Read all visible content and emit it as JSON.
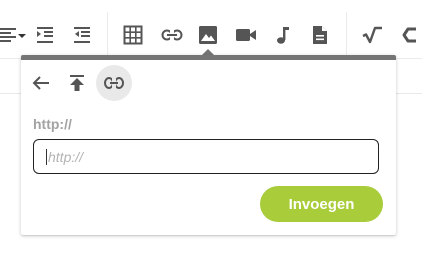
{
  "toolbar": {
    "buttons": [
      {
        "name": "align-dropdown-icon"
      },
      {
        "name": "indent-icon"
      },
      {
        "name": "outdent-icon"
      },
      {
        "name": "table-icon"
      },
      {
        "name": "link-icon"
      },
      {
        "name": "image-icon"
      },
      {
        "name": "video-icon"
      },
      {
        "name": "audio-icon"
      },
      {
        "name": "file-icon"
      },
      {
        "name": "math-icon"
      },
      {
        "name": "code-icon"
      }
    ],
    "active": "image-icon"
  },
  "popup": {
    "actions": [
      "back-icon",
      "upload-icon",
      "link-icon"
    ],
    "selected_action": "link-icon",
    "field_label": "http://",
    "url_input": {
      "value": "",
      "placeholder": "http://"
    },
    "insert_label": "Invoegen"
  },
  "colors": {
    "accent": "#a8cc3a",
    "icon": "#555555",
    "popup_border": "#757575"
  }
}
